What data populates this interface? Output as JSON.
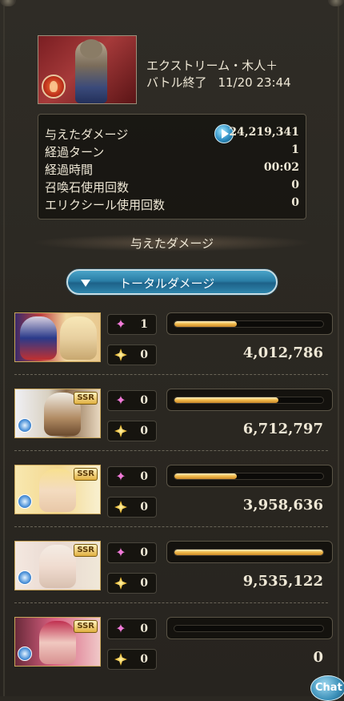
{
  "quest": {
    "title": "エクストリーム・木人＋",
    "status": "バトル終了",
    "timestamp": "11/20 23:44"
  },
  "stats": [
    {
      "label": "与えたダメージ",
      "value": "24,219,341"
    },
    {
      "label": "経過ターン",
      "value": "1"
    },
    {
      "label": "経過時間",
      "value": "00:02"
    },
    {
      "label": "召喚石使用回数",
      "value": "0"
    },
    {
      "label": "エリクシール使用回数",
      "value": "0"
    }
  ],
  "section_title": "与えたダメージ",
  "dropdown_label": "トータルダメージ",
  "members": [
    {
      "rarity": "",
      "skill_count": "1",
      "ougi_count": "0",
      "damage": "4,012,786",
      "bar_fraction": 0.42
    },
    {
      "rarity": "SSR",
      "skill_count": "0",
      "ougi_count": "0",
      "damage": "6,712,797",
      "bar_fraction": 0.7
    },
    {
      "rarity": "SSR",
      "skill_count": "0",
      "ougi_count": "0",
      "damage": "3,958,636",
      "bar_fraction": 0.42
    },
    {
      "rarity": "SSR",
      "skill_count": "0",
      "ougi_count": "0",
      "damage": "9,535,122",
      "bar_fraction": 1.0
    },
    {
      "rarity": "SSR",
      "skill_count": "0",
      "ougi_count": "0",
      "damage": "0",
      "bar_fraction": 0.0
    }
  ],
  "chat_label": "Chat",
  "colors": {
    "bar_fill": "#f0b848",
    "accent_blue": "#2a7ea6",
    "background": "#2b2822"
  }
}
